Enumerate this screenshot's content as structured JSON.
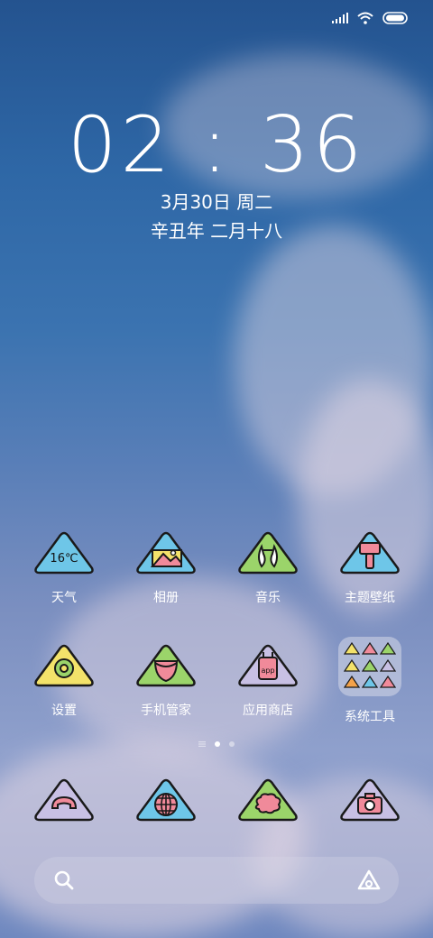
{
  "status_bar": {
    "signal_icon": "signal-bars-icon",
    "wifi_icon": "wifi-icon",
    "battery_icon": "battery-icon"
  },
  "lockscreen": {
    "time": "02 : 36",
    "date": "3月30日 周二",
    "lunar_date": "辛丑年 二月十八"
  },
  "apps": [
    {
      "label": "天气",
      "icon": "weather-icon",
      "icon_text": "16℃",
      "color": "#6ec6e8"
    },
    {
      "label": "相册",
      "icon": "gallery-icon",
      "color": "#6ec6e8"
    },
    {
      "label": "音乐",
      "icon": "music-icon",
      "color": "#9bd46a"
    },
    {
      "label": "主题壁纸",
      "icon": "theme-icon",
      "color": "#6ec6e8"
    },
    {
      "label": "设置",
      "icon": "settings-icon",
      "color": "#f3e26a"
    },
    {
      "label": "手机管家",
      "icon": "security-icon",
      "color": "#9bd46a"
    },
    {
      "label": "应用商店",
      "icon": "app-store-icon",
      "icon_text": "app",
      "color": "#c8c0e4"
    },
    {
      "label": "系统工具",
      "icon": "folder-icon",
      "color": "#e8e6f0"
    }
  ],
  "dock": [
    {
      "name": "phone",
      "icon": "phone-icon",
      "color": "#c8c0e4"
    },
    {
      "name": "browser",
      "icon": "globe-icon",
      "color": "#6ec6e8"
    },
    {
      "name": "messages",
      "icon": "message-icon",
      "color": "#9bd46a"
    },
    {
      "name": "camera",
      "icon": "camera-icon",
      "color": "#c8c0e4"
    }
  ],
  "search": {
    "search_icon": "search-icon",
    "assistant_icon": "assistant-icon"
  },
  "page_indicator": {
    "pages": 2,
    "current": 1
  }
}
